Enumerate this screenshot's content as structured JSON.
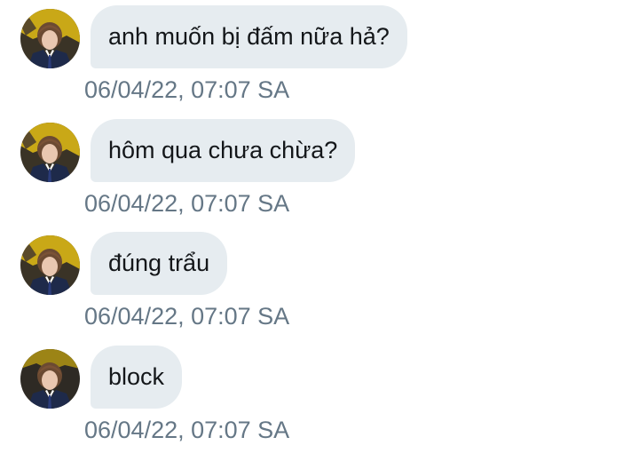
{
  "messages": [
    {
      "text": "anh muốn bị đấm nữa hả?",
      "time": "06/04/22, 07:07 SA"
    },
    {
      "text": "hôm qua chưa chừa?",
      "time": "06/04/22, 07:07 SA"
    },
    {
      "text": "đúng trẩu",
      "time": "06/04/22, 07:07 SA"
    },
    {
      "text": "block",
      "time": "06/04/22, 07:07 SA"
    }
  ],
  "colors": {
    "bubble_bg": "#e6ecf0",
    "message_text": "#14171a",
    "timestamp_text": "#657786",
    "background": "#ffffff"
  }
}
